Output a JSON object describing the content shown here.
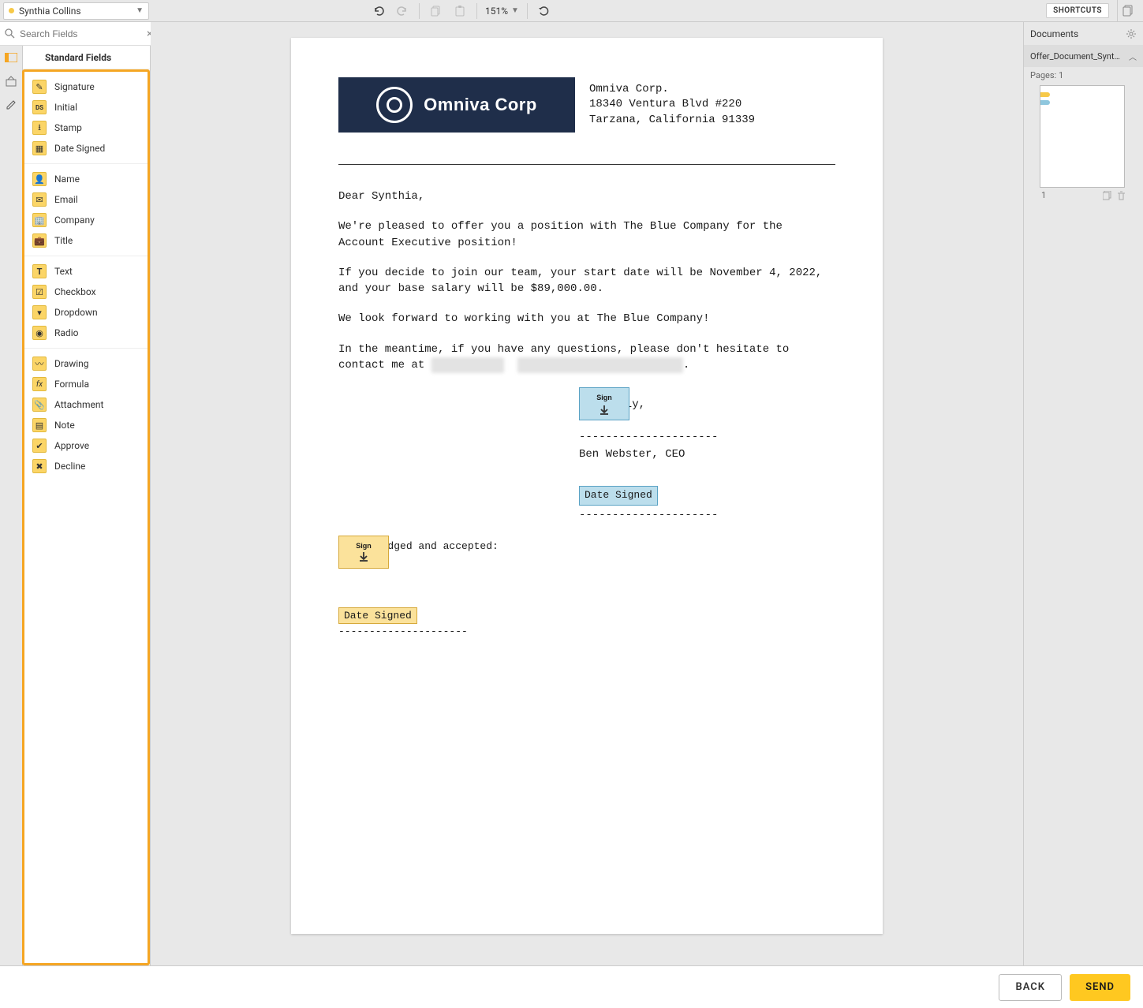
{
  "topbar": {
    "recipient_name": "Synthia Collins",
    "zoom_level": "151%",
    "shortcuts_label": "SHORTCUTS"
  },
  "search": {
    "placeholder": "Search Fields"
  },
  "panel": {
    "title": "Standard Fields"
  },
  "fields": {
    "group1": [
      {
        "label": "Signature",
        "glyph": "✎"
      },
      {
        "label": "Initial",
        "glyph": "DS"
      },
      {
        "label": "Stamp",
        "glyph": "⭳"
      },
      {
        "label": "Date Signed",
        "glyph": "▦"
      }
    ],
    "group2": [
      {
        "label": "Name",
        "glyph": "👤"
      },
      {
        "label": "Email",
        "glyph": "✉"
      },
      {
        "label": "Company",
        "glyph": "🏢"
      },
      {
        "label": "Title",
        "glyph": "💼"
      }
    ],
    "group3": [
      {
        "label": "Text",
        "glyph": "T"
      },
      {
        "label": "Checkbox",
        "glyph": "☑"
      },
      {
        "label": "Dropdown",
        "glyph": "▾"
      },
      {
        "label": "Radio",
        "glyph": "◉"
      }
    ],
    "group4": [
      {
        "label": "Drawing",
        "glyph": "〰"
      },
      {
        "label": "Formula",
        "glyph": "fx"
      },
      {
        "label": "Attachment",
        "glyph": "📎"
      },
      {
        "label": "Note",
        "glyph": "▤"
      },
      {
        "label": "Approve",
        "glyph": "✔"
      },
      {
        "label": "Decline",
        "glyph": "✖"
      }
    ]
  },
  "document": {
    "company_name": "Omniva Corp",
    "company_logo_text": "Omniva Corp",
    "address_line1": "Omniva Corp.",
    "address_line2": "18340 Ventura Blvd #220",
    "address_line3": "Tarzana, California 91339",
    "greeting": "Dear Synthia,",
    "para1": "We're pleased to offer you a position with The Blue Company for the Account Executive position!",
    "para2": "If you decide to join our team, your start date will be November 4, 2022, and your base salary will be $89,000.00.",
    "para3": "We look forward to working with you at The Blue Company!",
    "para4_prefix": "In the meantime, if you have any questions, please don't hesitate to contact me at ",
    "para4_suffix": ".",
    "closing_word": "Sincerely,",
    "signer_line": "Ben Webster, CEO",
    "dash_line": "---------------------",
    "ack_text": "Acknowledged and accepted:",
    "sign_label": "Sign",
    "date_signed_label": "Date Signed"
  },
  "docs_panel": {
    "header": "Documents",
    "doc_name": "Offer_Document_Synt…",
    "pages_label": "Pages: 1",
    "page_number": "1"
  },
  "footer": {
    "back_label": "BACK",
    "send_label": "SEND"
  }
}
